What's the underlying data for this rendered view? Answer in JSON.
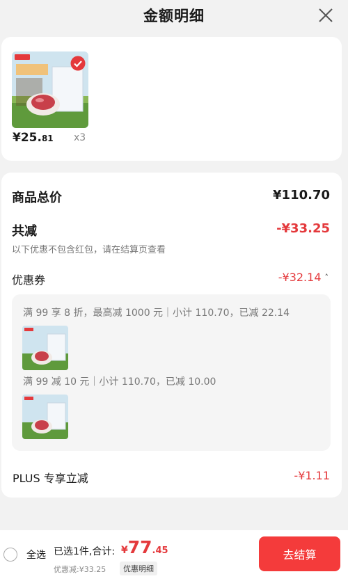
{
  "header": {
    "title": "金额明细",
    "close_icon": "close-icon"
  },
  "product": {
    "price_int": "¥25.",
    "price_dec": "81",
    "qty": "x3",
    "image_icon": "beef-product-image",
    "check_icon": "check-icon"
  },
  "summary": {
    "total_label": "商品总价",
    "total_value": "¥110.70",
    "discount_label": "共减",
    "discount_value": "-¥33.25",
    "note": "以下优惠不包含红包，请在结算页查看"
  },
  "coupon": {
    "label": "优惠券",
    "value": "-¥32.14",
    "caret_icon": "chevron-up-icon",
    "items": [
      {
        "text": "满 99 享 8 折，最高减 1000 元｜小计 110.70，已减 22.14"
      },
      {
        "text": "满 99 减 10 元｜小计 110.70，已减 10.00"
      }
    ]
  },
  "plus": {
    "label": "PLUS 专享立减",
    "value": "-¥1.11"
  },
  "footer": {
    "select_all": "全选",
    "selected_info": "已选1件,合计:",
    "total_cur": "¥",
    "total_int": "77",
    "total_dec": ".45",
    "discount_info": "优惠减:¥33.25",
    "detail_chip": "优惠明细",
    "checkout": "去结算"
  },
  "colors": {
    "accent": "#e4393c",
    "checkout_bg": "#f43b3b",
    "page_bg": "#f2f2f2"
  }
}
